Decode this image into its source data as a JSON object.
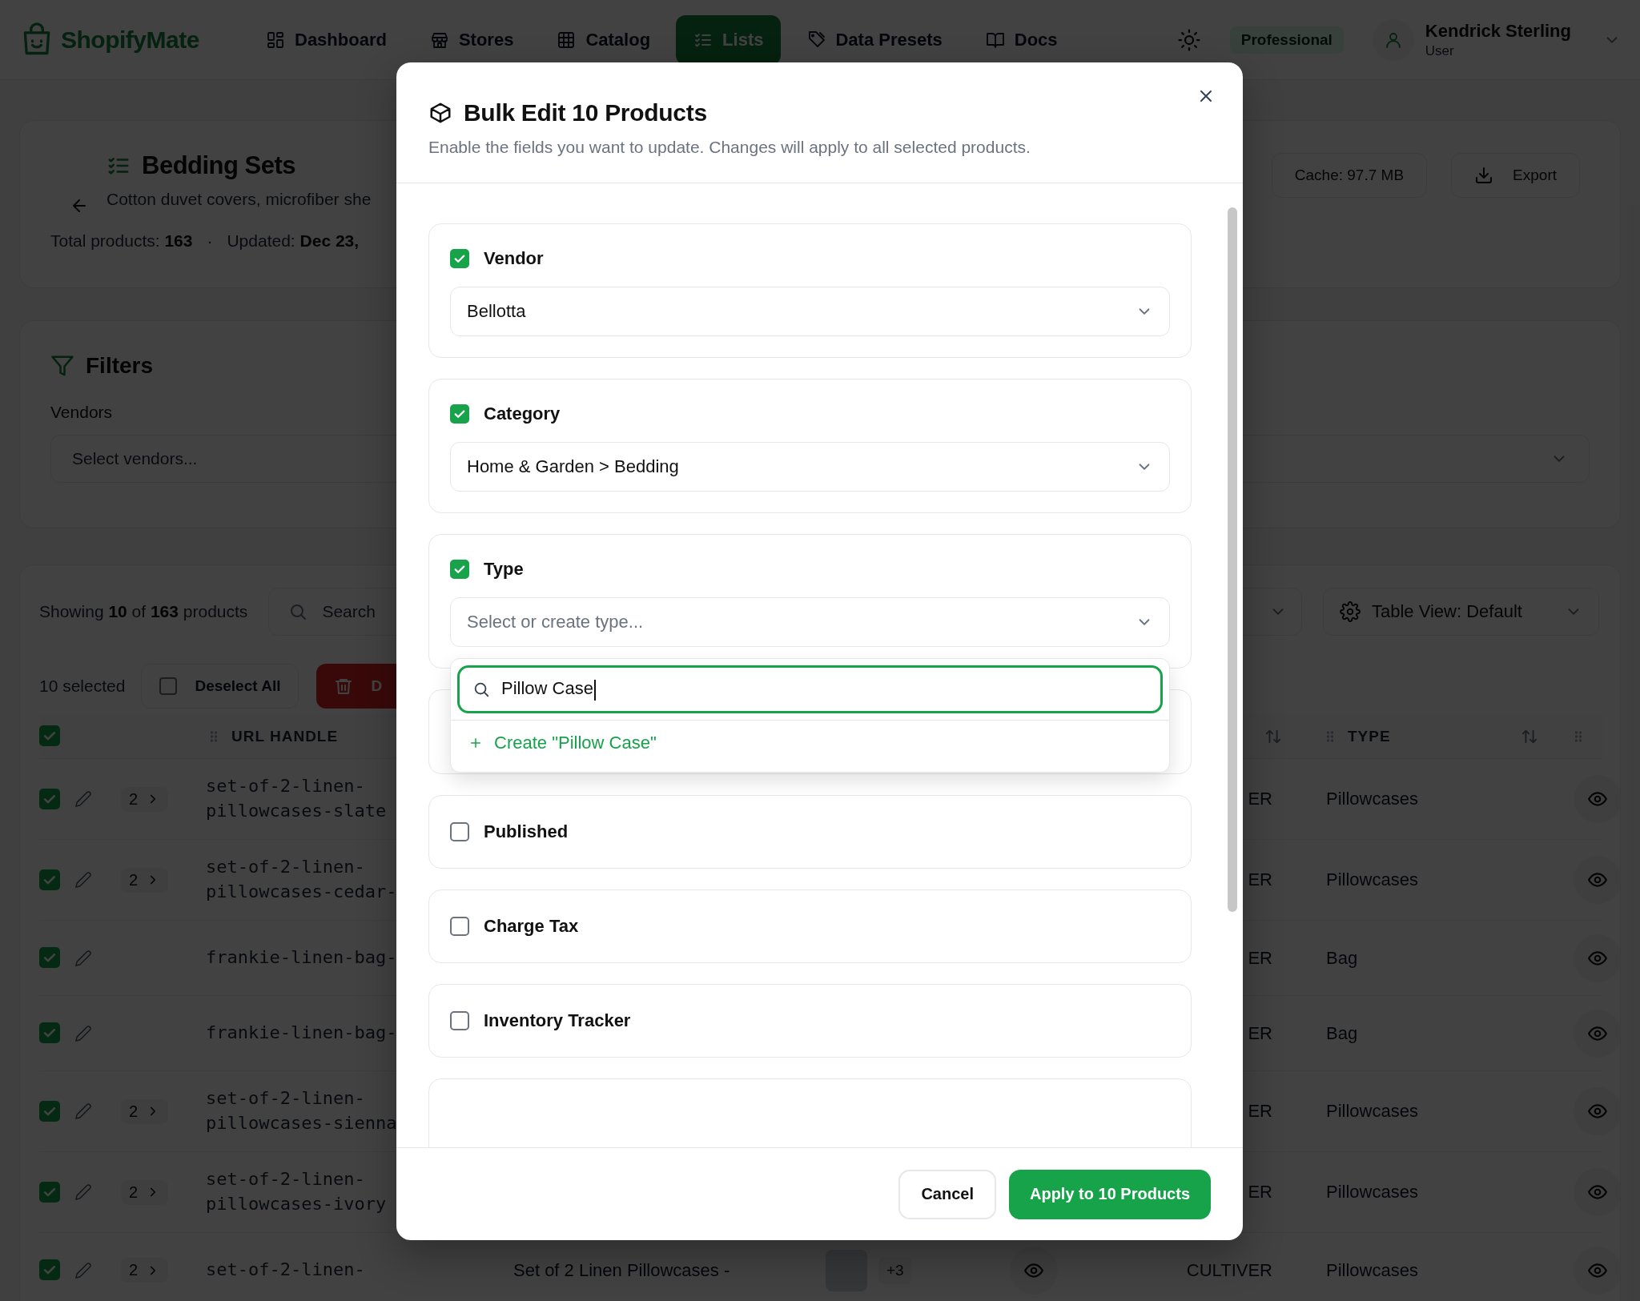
{
  "app": {
    "logo": "ShopifyMate"
  },
  "nav": [
    {
      "label": "Dashboard",
      "selected": false
    },
    {
      "label": "Stores",
      "selected": false
    },
    {
      "label": "Catalog",
      "selected": false
    },
    {
      "label": "Lists",
      "selected": true
    },
    {
      "label": "Data Presets",
      "selected": false
    },
    {
      "label": "Docs",
      "selected": false
    }
  ],
  "user": {
    "plan": "Professional",
    "name": "Kendrick Sterling",
    "role": "User"
  },
  "list_header": {
    "title": "Bedding Sets",
    "description": "Cotton duvet covers, microfiber she",
    "stats": "Total products: **163**",
    "separator": "·",
    "updated": "Updated: **Dec 23,**",
    "cache": "Cache: 97.7 MB",
    "export": "Export"
  },
  "filters": {
    "title": "Filters",
    "vendors_label": "Vendors",
    "vendors_placeholder": "Select vendors..."
  },
  "table": {
    "showing": "Showing **10** of **163** products",
    "search_placeholder": "Search",
    "view_button": "Table View: Default",
    "selected_count": "10 selected",
    "deselect": "Deselect All",
    "delete": "D",
    "header_checked": true,
    "columns": [
      {
        "label": "URL HANDLE"
      },
      {
        "label": "TYPE"
      }
    ],
    "rows": [
      {
        "checked": true,
        "variants": "2",
        "handle": "set-of-2-linen-pillowcases-slate",
        "vendor": "ER",
        "type": "Pillowcases"
      },
      {
        "checked": true,
        "variants": "2",
        "handle": "set-of-2-linen-pillowcases-cedar-",
        "vendor": "ER",
        "type": "Pillowcases"
      },
      {
        "checked": true,
        "handle": "frankie-linen-bag-",
        "vendor": "ER",
        "type": "Bag"
      },
      {
        "checked": true,
        "handle": "frankie-linen-bag-",
        "vendor": "ER",
        "type": "Bag"
      },
      {
        "checked": true,
        "variants": "2",
        "handle": "set-of-2-linen-pillowcases-sienna",
        "vendor": "ER",
        "type": "Pillowcases"
      },
      {
        "checked": true,
        "variants": "2",
        "handle": "set-of-2-linen-pillowcases-ivory",
        "vendor": "ER",
        "type": "Pillowcases"
      },
      {
        "checked": true,
        "variants": "2",
        "handle": "set-of-2-linen-",
        "title": "Set of 2 Linen Pillowcases -",
        "extra_images": "+3",
        "published": true,
        "vendor": "CULTIVER",
        "type": "Pillowcases"
      }
    ]
  },
  "modal": {
    "title": "Bulk Edit 10 Products",
    "subtitle": "Enable the fields you want to update. Changes will apply to all selected products.",
    "fields": [
      {
        "kind": "select",
        "label": "Vendor",
        "enabled": true,
        "value": "Bellotta"
      },
      {
        "kind": "select",
        "label": "Category",
        "enabled": true,
        "value": "Home & Garden > Bedding"
      },
      {
        "kind": "combobox",
        "label": "Type",
        "enabled": true,
        "placeholder": "Select or create type...",
        "expanded": true,
        "search_value": "Pillow Case",
        "create_option": "Create \"Pillow Case\""
      },
      {
        "kind": "covered"
      },
      {
        "kind": "toggle",
        "label": "Published",
        "enabled": false
      },
      {
        "kind": "toggle",
        "label": "Charge Tax",
        "enabled": false
      },
      {
        "kind": "toggle",
        "label": "Inventory Tracker",
        "enabled": false
      },
      {
        "kind": "covered"
      }
    ],
    "cancel": "Cancel",
    "apply": "Apply to 10 Products"
  }
}
